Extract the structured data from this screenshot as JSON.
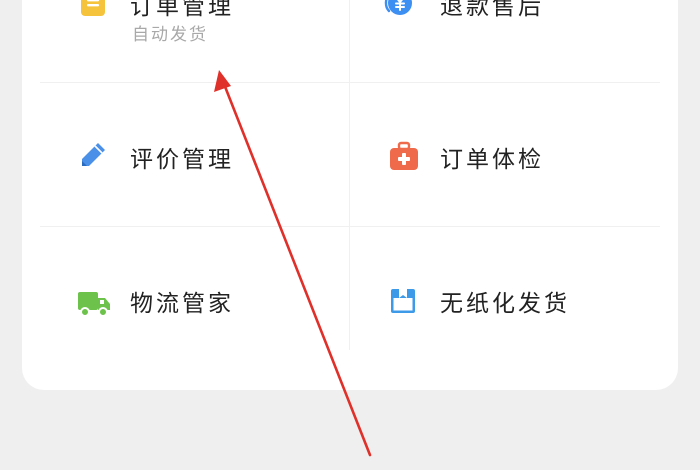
{
  "menu": {
    "items": [
      {
        "label": "订单管理",
        "sub": "自动发货",
        "icon": "document-icon",
        "color": "#f5c43c"
      },
      {
        "label": "退款售后",
        "icon": "yen-refund-icon",
        "color": "#3d8ff2"
      },
      {
        "label": "评价管理",
        "icon": "pencil-icon",
        "color": "#4a8fe8"
      },
      {
        "label": "订单体检",
        "icon": "medical-kit-icon",
        "color": "#ef6a4a"
      },
      {
        "label": "物流管家",
        "icon": "delivery-truck-icon",
        "color": "#6cc24a"
      },
      {
        "label": "无纸化发货",
        "icon": "box-icon",
        "color": "#3d9ae8"
      }
    ]
  },
  "annotation": {
    "color": "#e0302a"
  }
}
